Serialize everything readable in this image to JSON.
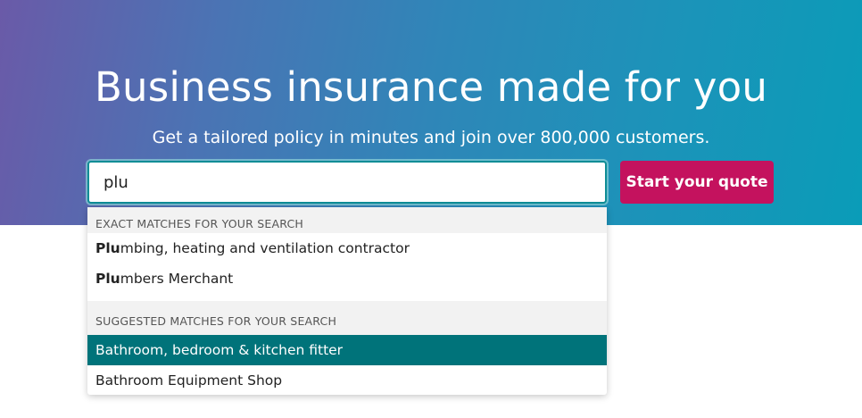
{
  "hero": {
    "title": "Business insurance made for you",
    "subtitle": "Get a tailored policy in minutes and join over 800,000 customers."
  },
  "search": {
    "value": "plu",
    "button_label": "Start your quote"
  },
  "dropdown": {
    "exact_header": "EXACT MATCHES FOR YOUR SEARCH",
    "exact_items": [
      {
        "match": "Plu",
        "rest": "mbing, heating and ventilation contractor"
      },
      {
        "match": "Plu",
        "rest": "mbers Merchant"
      }
    ],
    "suggested_header": "SUGGESTED MATCHES FOR YOUR SEARCH",
    "suggested_items": [
      {
        "label": "Bathroom, bedroom & kitchen fitter",
        "highlighted": true
      },
      {
        "label": "Bathroom Equipment Shop",
        "highlighted": false
      }
    ]
  },
  "colors": {
    "button": "#c4125e",
    "highlight": "#00737a",
    "gradient_start": "#6a5aa8",
    "gradient_end": "#0a9cb8"
  }
}
